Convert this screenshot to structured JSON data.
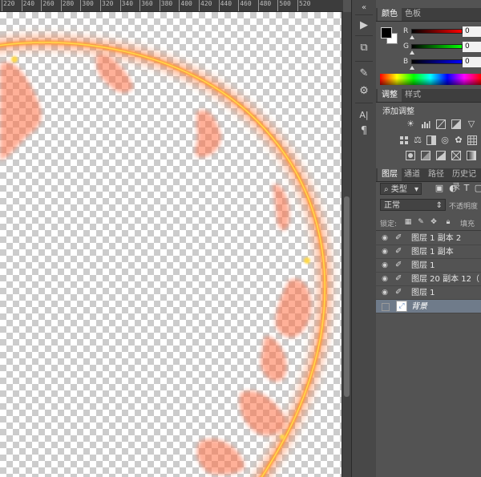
{
  "ruler": {
    "ticks": [
      "220",
      "240",
      "260",
      "280",
      "300",
      "320",
      "340",
      "360",
      "380",
      "400",
      "420",
      "440",
      "460",
      "480",
      "500",
      "520"
    ]
  },
  "tools": {
    "expand": "«",
    "play": "▶",
    "history": "⧉",
    "brush_preset": "✎",
    "adjust": "⚙",
    "type": "A|",
    "paragraph": "¶"
  },
  "color_panel": {
    "tabs": [
      "颜色",
      "色板"
    ],
    "foreground": "#000000",
    "background": "#ffffff",
    "sliders": [
      {
        "label": "R",
        "value": "0"
      },
      {
        "label": "G",
        "value": "0"
      },
      {
        "label": "B",
        "value": "0"
      }
    ]
  },
  "adjust_panel": {
    "tabs": [
      "调整",
      "样式"
    ],
    "title": "添加调整",
    "row1": [
      "brightness-icon",
      "levels-icon",
      "curves-icon",
      "exposure-icon",
      "vibrance-icon"
    ],
    "row2": [
      "hue-icon",
      "color-balance-icon",
      "bw-icon",
      "photo-filter-icon",
      "channel-mixer-icon",
      "lookup-icon"
    ],
    "row3": [
      "invert-icon",
      "posterize-icon",
      "threshold-icon",
      "selective-color-icon",
      "gradient-map-icon"
    ]
  },
  "layers_panel": {
    "tabs": [
      "图层",
      "通道",
      "路径",
      "历史记录"
    ],
    "filter_kind": "类型",
    "blend_mode": "正常",
    "opacity_label": "不透明度",
    "lock_label": "锁定:",
    "fill_label": "填充",
    "layers": [
      {
        "name": "图层 1 副本 2",
        "visible": true,
        "selected": false
      },
      {
        "name": "图层 1 副本",
        "visible": true,
        "selected": false
      },
      {
        "name": "图层 1",
        "visible": true,
        "selected": false
      },
      {
        "name": "图层 20 副本 12（…",
        "visible": true,
        "selected": false
      },
      {
        "name": "图层 1",
        "visible": true,
        "selected": false
      },
      {
        "name": "背景",
        "visible": false,
        "selected": true
      }
    ]
  },
  "colors": {
    "fire_outer": "#ff7a3a",
    "fire_core": "#ffd84a",
    "panel_bg": "#535353"
  }
}
